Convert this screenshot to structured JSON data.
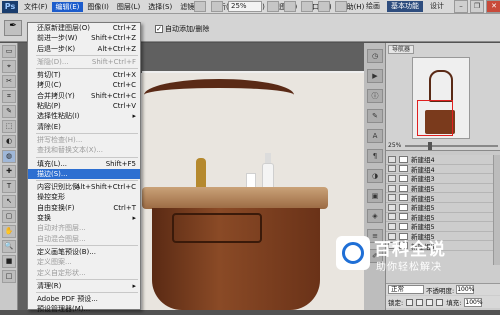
{
  "titlebar": {
    "logo": "Ps",
    "menus": [
      "文件(F)",
      "编辑(E)",
      "图像(I)",
      "图层(L)",
      "选择(S)",
      "滤镜(T)",
      "分析(A)",
      "3D(D)",
      "视图(V)",
      "窗口(W)",
      "帮助(H)"
    ],
    "active_menu": "编辑(E)",
    "zoom": "25%",
    "workspaces": [
      "基本功能",
      "设计"
    ],
    "workspace_extra": "绘画",
    "active_workspace": "基本功能",
    "window_controls": {
      "minimize": "–",
      "restore": "❐",
      "close": "✕"
    }
  },
  "options": {
    "auto_add_delete": "自动添加/删除",
    "auto_checked": true
  },
  "edit_menu": {
    "items": [
      {
        "label": "还原新建图层(O)",
        "shortcut": "Ctrl+Z",
        "state": "normal"
      },
      {
        "label": "前进一步(W)",
        "shortcut": "Shift+Ctrl+Z",
        "state": "normal"
      },
      {
        "label": "后退一步(K)",
        "shortcut": "Alt+Ctrl+Z",
        "state": "normal"
      },
      {
        "sep": true
      },
      {
        "label": "渐隐(D)...",
        "shortcut": "Shift+Ctrl+F",
        "state": "disabled"
      },
      {
        "sep": true
      },
      {
        "label": "剪切(T)",
        "shortcut": "Ctrl+X",
        "state": "normal"
      },
      {
        "label": "拷贝(C)",
        "shortcut": "Ctrl+C",
        "state": "normal"
      },
      {
        "label": "合并拷贝(Y)",
        "shortcut": "Shift+Ctrl+C",
        "state": "normal"
      },
      {
        "label": "粘贴(P)",
        "shortcut": "Ctrl+V",
        "state": "normal"
      },
      {
        "label": "选择性粘贴(I)",
        "shortcut": "",
        "state": "normal",
        "submenu": true
      },
      {
        "label": "清除(E)",
        "shortcut": "",
        "state": "normal"
      },
      {
        "sep": true
      },
      {
        "label": "拼写检查(H)...",
        "shortcut": "",
        "state": "disabled"
      },
      {
        "label": "查找和替换文本(X)...",
        "shortcut": "",
        "state": "disabled"
      },
      {
        "sep": true
      },
      {
        "label": "填充(L)...",
        "shortcut": "Shift+F5",
        "state": "normal"
      },
      {
        "label": "描边(S)...",
        "shortcut": "",
        "state": "highlight"
      },
      {
        "sep": true
      },
      {
        "label": "内容识别比例",
        "shortcut": "Alt+Shift+Ctrl+C",
        "state": "normal"
      },
      {
        "label": "操控变形",
        "shortcut": "",
        "state": "normal"
      },
      {
        "label": "自由变换(F)",
        "shortcut": "Ctrl+T",
        "state": "normal"
      },
      {
        "label": "变换",
        "shortcut": "",
        "state": "normal",
        "submenu": true
      },
      {
        "label": "自动对齐图层...",
        "shortcut": "",
        "state": "disabled"
      },
      {
        "label": "自动混合图层...",
        "shortcut": "",
        "state": "disabled"
      },
      {
        "sep": true
      },
      {
        "label": "定义画笔预设(B)...",
        "shortcut": "",
        "state": "normal"
      },
      {
        "label": "定义图案...",
        "shortcut": "",
        "state": "disabled"
      },
      {
        "label": "定义自定形状...",
        "shortcut": "",
        "state": "disabled"
      },
      {
        "sep": true
      },
      {
        "label": "清理(R)",
        "shortcut": "",
        "state": "normal",
        "submenu": true
      },
      {
        "sep": true
      },
      {
        "label": "Adobe PDF 预设...",
        "shortcut": "",
        "state": "normal"
      },
      {
        "label": "预设管理器(M)...",
        "shortcut": "",
        "state": "normal"
      }
    ]
  },
  "navigator": {
    "tab_label": "导航器",
    "zoom": "25%",
    "zoom_level": 0.25
  },
  "layers": {
    "items": [
      "新建组4",
      "新建组4",
      "新建组3",
      "新建组5",
      "新建组5",
      "新建组5",
      "新建组5",
      "新建组5",
      "新建组5",
      "新建组5"
    ],
    "blend_mode": "正常",
    "opacity_label": "不透明度:",
    "opacity": "100%",
    "lock_label": "锁定:",
    "fill_label": "填充:",
    "fill": "100%"
  },
  "watermark": {
    "title": "百科全说",
    "subtitle": "助你轻松解决"
  },
  "tools": [
    "▭",
    "⌖",
    "✂",
    "⌗",
    "✎",
    "⬚",
    "◐",
    "◍",
    "✚",
    "T",
    "↖",
    "▢",
    "✋",
    "🔍",
    "■",
    "□"
  ]
}
